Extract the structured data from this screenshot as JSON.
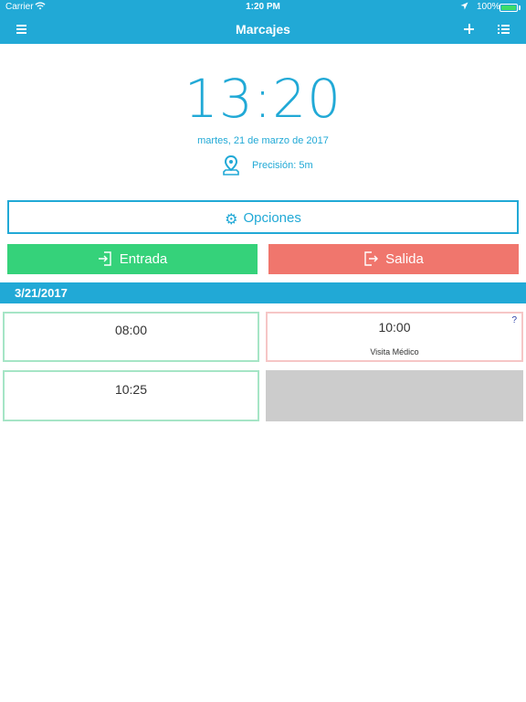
{
  "statusbar": {
    "carrier": "Carrier",
    "time": "1:20 PM",
    "battery": "100%"
  },
  "navbar": {
    "title": "Marcajes",
    "menu_icon": "hamburger-menu-icon",
    "add_icon": "plus-icon",
    "list_icon": "list-icon"
  },
  "clock": {
    "time": "13:20",
    "date": "martes, 21 de marzo de 2017",
    "precision": "Precisión: 5m"
  },
  "actions": {
    "options_label": "Opciones",
    "entrada_label": "Entrada",
    "salida_label": "Salida"
  },
  "colors": {
    "primary": "#21a9d6",
    "entrada": "#35d27a",
    "salida": "#f0766d"
  },
  "section": {
    "date": "3/21/2017"
  },
  "records": [
    {
      "time": "08:00",
      "type": "entrada",
      "note": ""
    },
    {
      "time": "10:00",
      "type": "salida",
      "note": "Visita Médico",
      "flag": "?"
    },
    {
      "time": "10:25",
      "type": "entrada",
      "note": ""
    }
  ]
}
